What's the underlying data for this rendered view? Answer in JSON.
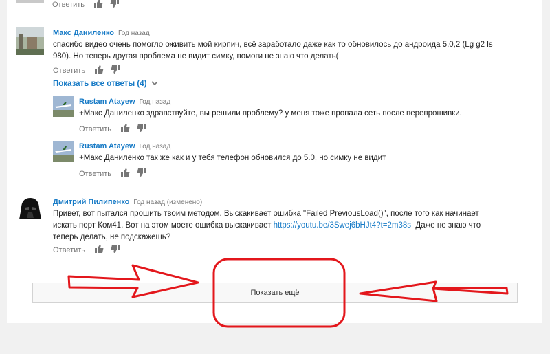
{
  "actions": {
    "reply_label": "Ответить"
  },
  "comments": [
    {
      "author": "Макс Даниленко",
      "time": "Год назад",
      "text_line1": "спасибо видео очень помогло оживить мой кирпич, всё заработало даже как то обновилось до андроида 5,0,2 (Lg g2 ls",
      "text_line2": "980). Но теперь другая проблема не видит симку, помоги не знаю что делать("
    },
    {
      "author": "Дмитрий Пилипенко",
      "time": "Год назад (изменено)",
      "text_line1": "Привет, вот пытался прошить твоим методом. Выскакивает ошибка \"Failed PreviousLoad()\", после того как начинает",
      "text_line2_prefix": "искать порт Ком41. Вот на этом моете ошибка выскакивает ",
      "link": "https://youtu.be/3Swej6bHJt4?t=2m38s",
      "text_line2_suffix": "  Даже не знаю что",
      "text_line3": "теперь делать, не подскажешь?"
    }
  ],
  "show_replies_label": "Показать все ответы (4)",
  "replies": [
    {
      "author": "Rustam Atayew",
      "time": "Год назад",
      "text": "+Макс Даниленко здравствуйте, вы решили проблему? у меня тоже пропала сеть после перепрошивки."
    },
    {
      "author": "Rustam Atayew",
      "time": "Год назад",
      "text": "+Макс Даниленко так же как и у тебя телефон обновился до 5.0, но симку не видит"
    }
  ],
  "show_more_label": "Показать ещё",
  "colors": {
    "link": "#167ac6",
    "annotation": "#e3171c"
  }
}
